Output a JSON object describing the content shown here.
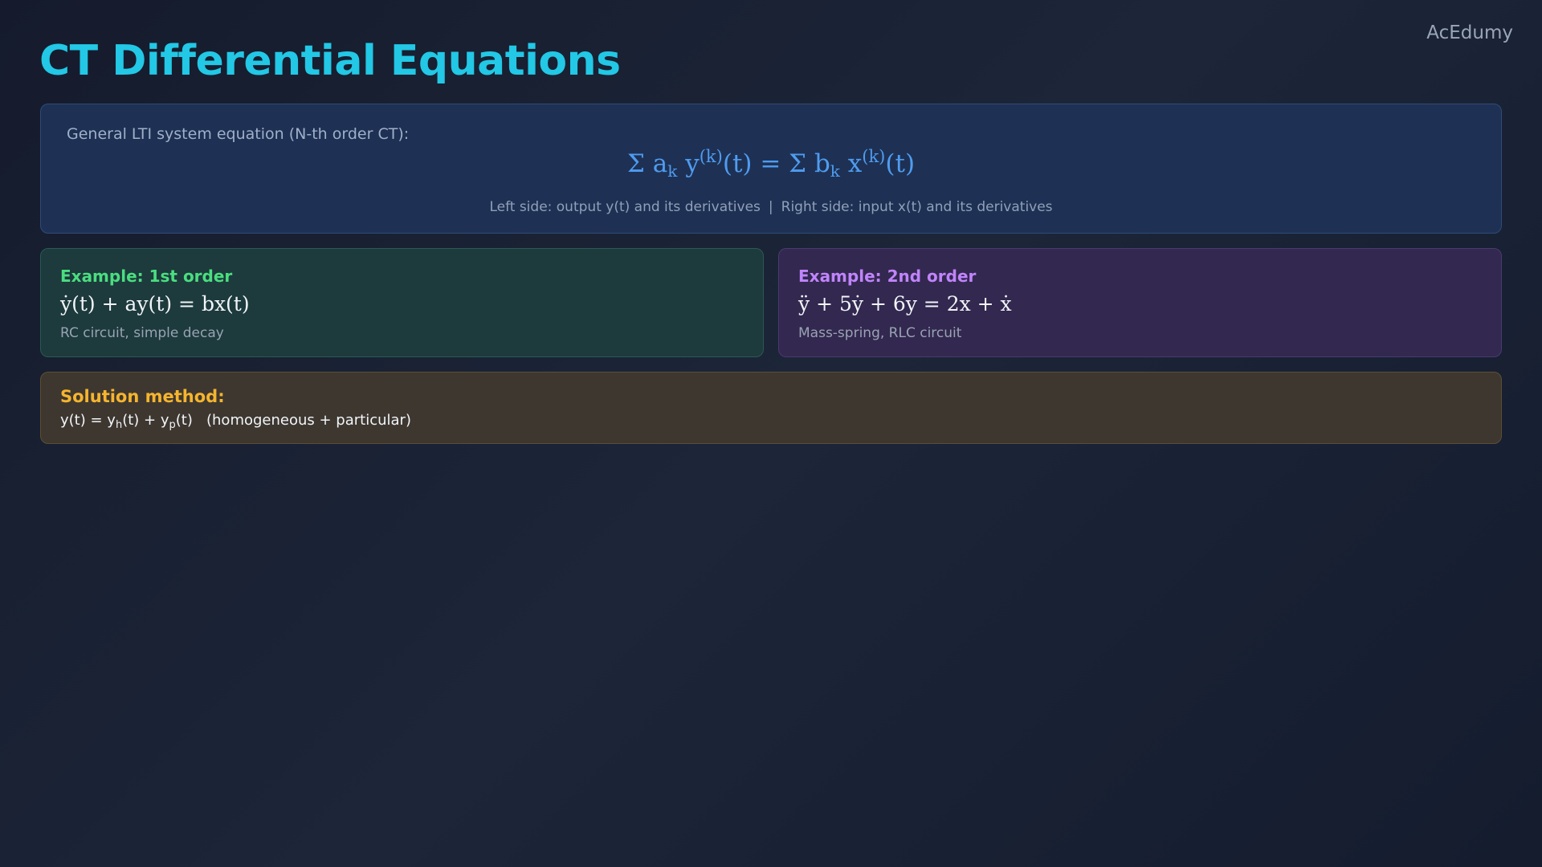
{
  "brand": "AcEdumy",
  "title": "CT Differential Equations",
  "general": {
    "intro": "General LTI system equation (N-th order CT):",
    "equation": {
      "sum1": "Σ a",
      "sub1": "k",
      "y": " y",
      "sup1": "(k)",
      "mid": "(t) = Σ b",
      "sub2": "k",
      "x": " x",
      "sup2": "(k)",
      "end": "(t)"
    },
    "note_left": "Left side: output y(t) and its derivatives",
    "note_sep": "|",
    "note_right": "Right side: input x(t) and its derivatives"
  },
  "examples": [
    {
      "title": "Example: 1st order",
      "equation": "ẏ(t) + ay(t) = bx(t)",
      "description": "RC circuit, simple decay"
    },
    {
      "title": "Example: 2nd order",
      "equation": "ÿ + 5ẏ + 6y = 2x + ẋ",
      "description": "Mass-spring, RLC circuit"
    }
  ],
  "solution": {
    "title": "Solution method:",
    "eq": {
      "a": "y(t) = y",
      "sub_h": "h",
      "b": "(t) + y",
      "sub_p": "p",
      "c": "(t)   (homogeneous + particular)"
    }
  },
  "colors": {
    "title": "#22c8e5",
    "general_equation": "#4f9cf0",
    "example1_accent": "#4ade80",
    "example2_accent": "#c084fc",
    "solution_accent": "#f5b52e"
  }
}
